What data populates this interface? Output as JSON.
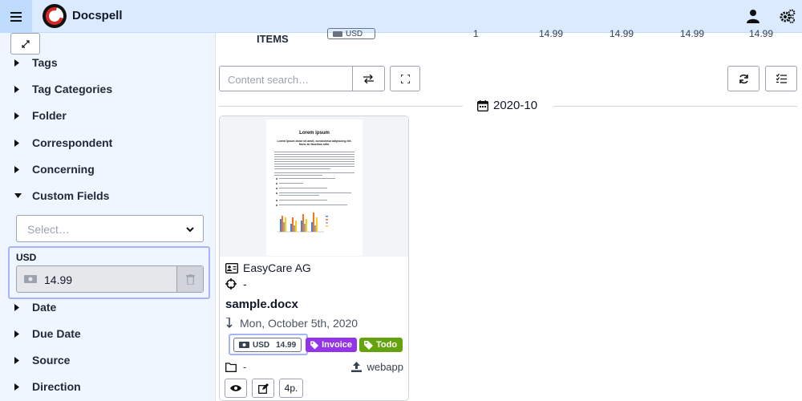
{
  "app": {
    "title": "Docspell"
  },
  "topbar": {
    "menu_icon": "hamburger-icon",
    "user_icon": "user-icon",
    "settings_icon": "gears-icon"
  },
  "sidebar": {
    "collapse_icon": "expand-arrows-icon",
    "items_before": [
      {
        "label": "Tags",
        "expanded": false
      },
      {
        "label": "Tag Categories",
        "expanded": false
      },
      {
        "label": "Folder",
        "expanded": false
      },
      {
        "label": "Correspondent",
        "expanded": false
      },
      {
        "label": "Concerning",
        "expanded": false
      },
      {
        "label": "Custom Fields",
        "expanded": true
      }
    ],
    "custom_fields": {
      "select_placeholder": "Select…",
      "field_label": "USD",
      "field_value": "14.99"
    },
    "items_after": [
      {
        "label": "Date",
        "expanded": false
      },
      {
        "label": "Due Date",
        "expanded": false
      },
      {
        "label": "Source",
        "expanded": false
      },
      {
        "label": "Direction",
        "expanded": false
      }
    ]
  },
  "stats": {
    "label": "ITEMS",
    "badge": "USD",
    "values": [
      "1",
      "14.99",
      "14.99",
      "14.99",
      "14.99"
    ]
  },
  "toolbar": {
    "search_placeholder": "Content search…"
  },
  "group": {
    "label": "2020-10"
  },
  "card": {
    "preview": {
      "title": "Lorem ipsum",
      "subtitle": "Lorem ipsum dolor sit amet, consectetur adipiscing elit. Nunc ac faucibus odio."
    },
    "correspondent": "EasyCare AG",
    "concerning": "-",
    "name": "sample.docx",
    "date": "Mon, October 5th, 2020",
    "custom_field": {
      "label": "USD",
      "value": "14.99"
    },
    "tags": [
      {
        "label": "Invoice",
        "color": "#9333ea"
      },
      {
        "label": "Todo",
        "color": "#65a30d"
      }
    ],
    "folder": "-",
    "source": "webapp",
    "pages": "4p."
  }
}
